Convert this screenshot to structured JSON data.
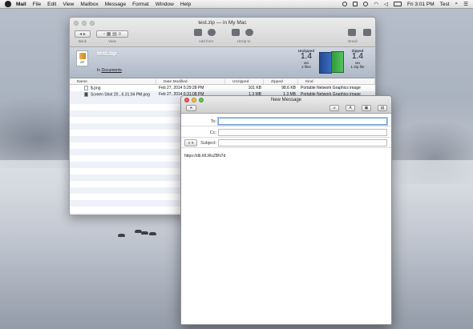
{
  "menubar": {
    "app": "Mail",
    "items": [
      "File",
      "Edit",
      "View",
      "Mailbox",
      "Message",
      "Format",
      "Window",
      "Help"
    ],
    "clock": "Fri 3:01 PM",
    "user": "Test"
  },
  "archive_window": {
    "title": "test.zip — in My Mac",
    "toolbar": {
      "back_label": "Back",
      "view_label": "View",
      "add_label": "Add from",
      "unzip_label": "Unzip to",
      "email_label": "Email"
    },
    "banner": {
      "file_name": "test.zip",
      "file_icon_text": "ZIP",
      "location_prefix": "In ",
      "location": "Documents",
      "unzipped_header": "Unzipped",
      "unzipped_value": "1.4",
      "unzipped_unit": "MB",
      "unzipped_sub": "2 files",
      "zipped_header": "Zipped",
      "zipped_value": "1.4",
      "zipped_unit": "MB",
      "zipped_sub": "1 Zip file"
    },
    "table": {
      "columns": [
        "Name",
        "Date Modified",
        "Unzipped",
        "Zipped",
        "Kind"
      ],
      "rows": [
        {
          "name": "$.png",
          "date": "Feb 27, 2014 5:29:28 PM",
          "unzipped": "101 KB",
          "zipped": "98.6 KB",
          "kind": "Portable Network Graphics image"
        },
        {
          "name": "Screen Shot 20...6.31.04 PM.png",
          "date": "Feb 27, 2014 6:31:08 PM",
          "unzipped": "1.3 MB",
          "zipped": "1.3 MB",
          "kind": "Portable Network Graphics image"
        }
      ]
    }
  },
  "message_window": {
    "title": "New Message",
    "to_label": "To:",
    "cc_label": "Cc:",
    "subject_label": "Subject:",
    "to_value": "",
    "cc_value": "",
    "subject_value": "",
    "body": "https://db.tt/LWsZBN7d"
  }
}
